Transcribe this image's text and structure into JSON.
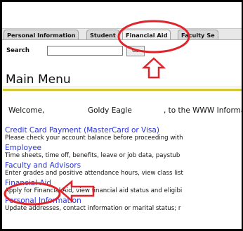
{
  "tabs": [
    {
      "label": "Personal Information"
    },
    {
      "label": "Student"
    },
    {
      "label": "Financial Aid"
    },
    {
      "label": "Faculty Se"
    }
  ],
  "search": {
    "label": "Search",
    "value": "",
    "go_label": "Go"
  },
  "page_title": "Main Menu",
  "welcome": {
    "prefix": "Welcome,",
    "name": "Goldy Eagle",
    "suffix": ", to the WWW Informat"
  },
  "menu": [
    {
      "link": "Credit Card Payment (MasterCard or Visa)",
      "desc": "Please check your account balance before proceeding with"
    },
    {
      "link": "Employee",
      "desc": "Time sheets, time off, benefits, leave or job data, paystub"
    },
    {
      "link": "Faculty and Advisors",
      "desc": "Enter grades and positive attendance hours, view class list"
    },
    {
      "link": "Financial Aid",
      "desc": "Apply for Financial Aid, view financial aid status and eligibi"
    },
    {
      "link": "Personal Information",
      "desc": "Update addresses, contact information or marital status; r"
    }
  ],
  "colors": {
    "link": "#2a35d6",
    "annotation": "#e0242c",
    "accent_rule": "#d4c52f"
  },
  "icons": {
    "tab_arrow": "up-arrow-icon",
    "link_arrow": "left-arrow-icon"
  }
}
